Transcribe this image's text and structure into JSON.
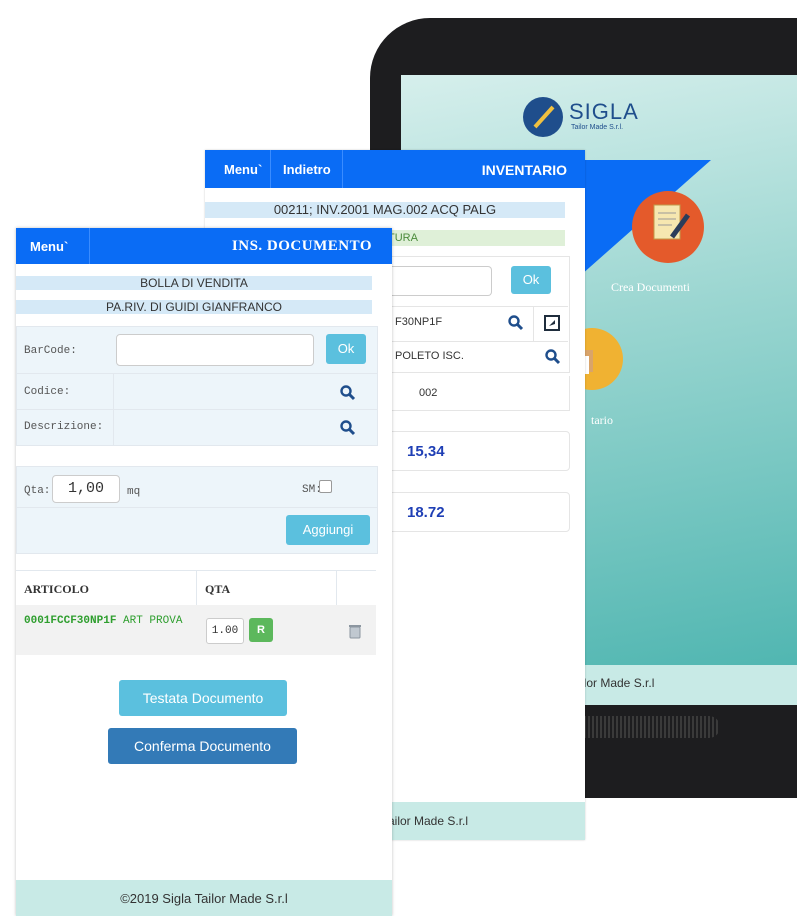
{
  "phone": {
    "logo_text": "SIGLA",
    "logo_sub": "Tailor Made S.r.l.",
    "crea_label": "Crea Documenti",
    "inventario_partial": "tario",
    "footer_text": "ilor Made S.r.l"
  },
  "inventario": {
    "nav_menu": "Menu`",
    "nav_back": "Indietro",
    "nav_title": "INVENTARIO",
    "band_doc": "00211; INV.2001 MAG.002 ACQ PALG",
    "band_green": "TURA",
    "ok_label": "Ok",
    "code_value": "F30NP1F",
    "desc_value": "POLETO ISC.",
    "mag_value": "002",
    "value1": "15,34",
    "value2": "18.72",
    "footer_text": "ailor Made S.r.l"
  },
  "documento": {
    "nav_menu": "Menu`",
    "nav_title": "INS. DOCUMENTO",
    "band_type": "BOLLA DI VENDITA",
    "band_client": "PA.RIV. DI GUIDI GIANFRANCO",
    "barcode_label": "BarCode:",
    "barcode_value": "",
    "ok_label": "Ok",
    "codice_label": "Codice:",
    "descrizione_label": "Descrizione:",
    "qta_label": "Qta:",
    "qta_value": "1,00",
    "unit": "mq",
    "sm_label": "SM:",
    "add_button": "Aggiungi",
    "table_headers": [
      "ARTICOLO",
      "QTA"
    ],
    "rows": [
      {
        "code": "0001FCCF30NP1F",
        "desc": "ART PROVA",
        "qta": "1.00",
        "r_label": "R"
      }
    ],
    "testata_button": "Testata Documento",
    "conferma_button": "Conferma Documento",
    "footer_text": "©2019 Sigla Tailor Made S.r.l"
  },
  "colors": {
    "nav_blue": "#0a6cf5",
    "ok_cyan": "#5bc0de",
    "green_code": "#2e9e2e",
    "confirm_blue": "#337ab7",
    "footer_teal": "#c8eae6"
  }
}
